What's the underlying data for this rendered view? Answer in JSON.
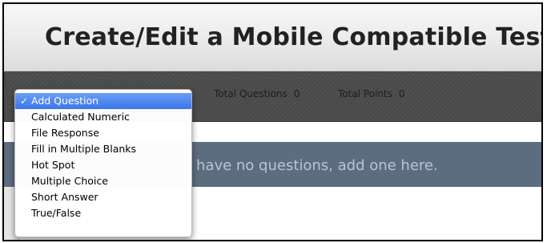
{
  "header": {
    "title": "Create/Edit a Mobile Compatible Test"
  },
  "toolbar": {
    "total_questions_label": "Total Questions",
    "total_questions_value": "0",
    "total_points_label": "Total Points",
    "total_points_value": "0"
  },
  "empty_message": "have no questions, add one here.",
  "dropdown": {
    "selected_value": "Add Question",
    "check_glyph": "✓",
    "items": [
      {
        "label": "Add Question"
      },
      {
        "label": "Calculated Numeric"
      },
      {
        "label": "File Response"
      },
      {
        "label": "Fill in Multiple Blanks"
      },
      {
        "label": "Hot Spot"
      },
      {
        "label": "Multiple Choice"
      },
      {
        "label": "Short Answer"
      },
      {
        "label": "True/False"
      }
    ]
  },
  "colors": {
    "toolbar_bg": "#4a4a4a",
    "message_bar_bg": "#5d6d80",
    "selection_blue": "#3b76ea"
  },
  "icons": {
    "selected_marker": "checkmark-icon"
  }
}
